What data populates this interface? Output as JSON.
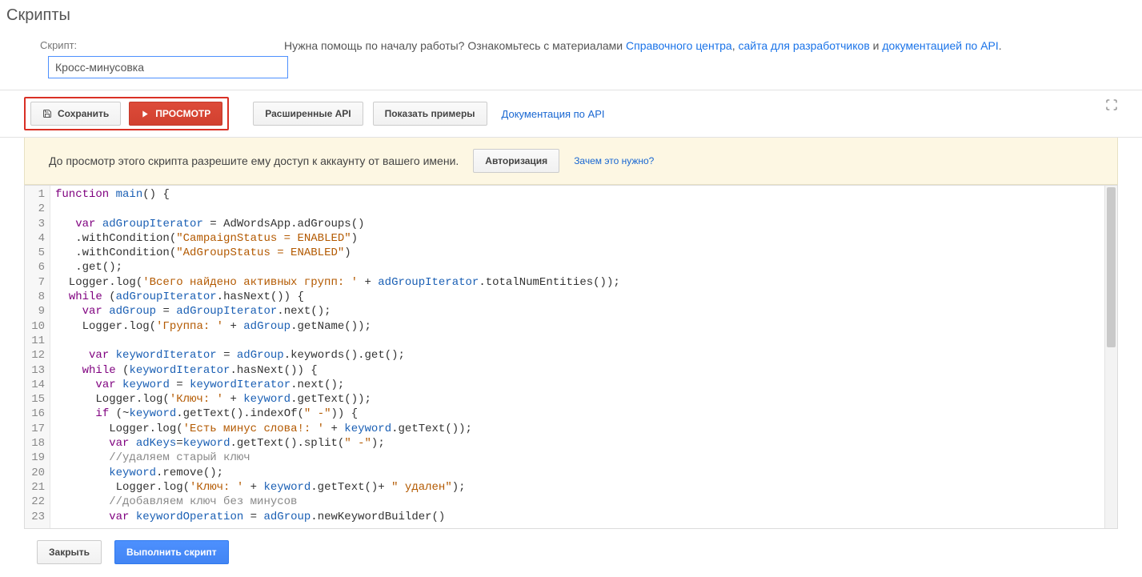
{
  "page_title": "Скрипты",
  "script_label": "Скрипт:",
  "help_text_prefix": "Нужна помощь по началу работы? Ознакомьтесь с материалами ",
  "help_link1": "Справочного центра",
  "help_sep1": ", ",
  "help_link2": "сайта для разработчиков",
  "help_sep2": " и ",
  "help_link3": "документацией по API",
  "help_suffix": ".",
  "script_name_value": "Кросс-минусовка",
  "toolbar": {
    "save": "Сохранить",
    "preview": "ПРОСМОТР",
    "advanced_api": "Расширенные API",
    "show_examples": "Показать примеры",
    "docs_link": "Документация по API"
  },
  "authbar": {
    "message": "До просмотр этого скрипта разрешите ему доступ к аккаунту от вашего имени.",
    "authorize": "Авторизация",
    "why": "Зачем это нужно?"
  },
  "footer": {
    "close": "Закрыть",
    "run": "Выполнить скрипт"
  },
  "code_lines": [
    {
      "n": 1,
      "html": "<span class='kw'>function</span> <span class='id'>main</span>() {"
    },
    {
      "n": 2,
      "html": ""
    },
    {
      "n": 3,
      "html": "   <span class='kw'>var</span> <span class='id'>adGroupIterator</span> = AdWordsApp.adGroups()"
    },
    {
      "n": 4,
      "html": "   .withCondition(<span class='str'>\"CampaignStatus = ENABLED\"</span>)"
    },
    {
      "n": 5,
      "html": "   .withCondition(<span class='str'>\"AdGroupStatus = ENABLED\"</span>)"
    },
    {
      "n": 6,
      "html": "   .get();"
    },
    {
      "n": 7,
      "html": "  Logger.log(<span class='str'>'Всего найдено активных групп: '</span> + <span class='id'>adGroupIterator</span>.totalNumEntities());"
    },
    {
      "n": 8,
      "html": "  <span class='kw'>while</span> (<span class='id'>adGroupIterator</span>.hasNext()) {"
    },
    {
      "n": 9,
      "html": "    <span class='kw'>var</span> <span class='id'>adGroup</span> = <span class='id'>adGroupIterator</span>.next();"
    },
    {
      "n": 10,
      "html": "    Logger.log(<span class='str'>'Группа: '</span> + <span class='id'>adGroup</span>.getName());"
    },
    {
      "n": 11,
      "html": ""
    },
    {
      "n": 12,
      "html": "     <span class='kw'>var</span> <span class='id'>keywordIterator</span> = <span class='id'>adGroup</span>.keywords().get();"
    },
    {
      "n": 13,
      "html": "    <span class='kw'>while</span> (<span class='id'>keywordIterator</span>.hasNext()) {"
    },
    {
      "n": 14,
      "html": "      <span class='kw'>var</span> <span class='id'>keyword</span> = <span class='id'>keywordIterator</span>.next();"
    },
    {
      "n": 15,
      "html": "      Logger.log(<span class='str'>'Ключ: '</span> + <span class='id'>keyword</span>.getText());"
    },
    {
      "n": 16,
      "html": "      <span class='kw'>if</span> (~<span class='id'>keyword</span>.getText().indexOf(<span class='str'>\" -\"</span>)) {"
    },
    {
      "n": 17,
      "html": "        Logger.log(<span class='str'>'Есть минус слова!: '</span> + <span class='id'>keyword</span>.getText());"
    },
    {
      "n": 18,
      "html": "        <span class='kw'>var</span> <span class='id'>adKeys</span>=<span class='id'>keyword</span>.getText().split(<span class='str'>\" -\"</span>);"
    },
    {
      "n": 19,
      "html": "        <span class='com'>//удаляем старый ключ</span>"
    },
    {
      "n": 20,
      "html": "        <span class='id'>keyword</span>.remove();"
    },
    {
      "n": 21,
      "html": "         Logger.log(<span class='str'>'Ключ: '</span> + <span class='id'>keyword</span>.getText()+ <span class='str'>\" удален\"</span>);"
    },
    {
      "n": 22,
      "html": "        <span class='com'>//добавляем ключ без минусов</span>"
    },
    {
      "n": 23,
      "html": "        <span class='kw'>var</span> <span class='id'>keywordOperation</span> = <span class='id'>adGroup</span>.newKeywordBuilder()"
    }
  ]
}
